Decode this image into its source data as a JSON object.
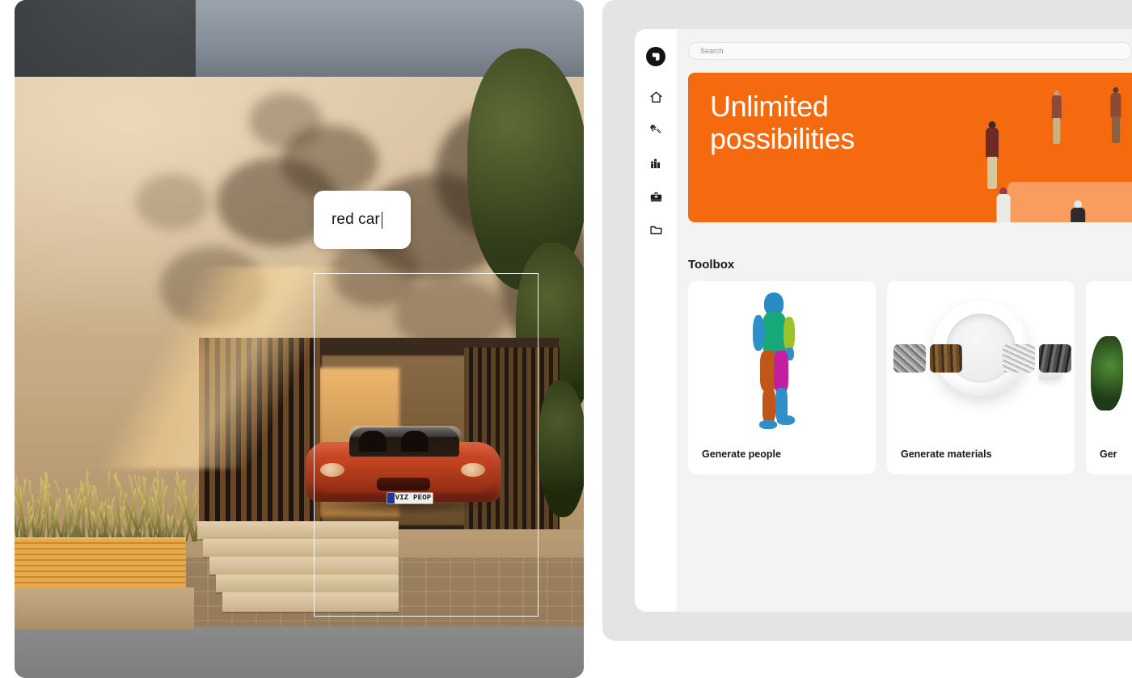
{
  "photo": {
    "name": "architectural-visualization-render",
    "prompt_input": {
      "value": "red car",
      "caret": true
    },
    "selection": {
      "name": "selection-marquee"
    },
    "car": {
      "license_plate": "VIZ PEOP"
    }
  },
  "app": {
    "rail": {
      "logo": "app-logo-icon",
      "items": [
        {
          "name": "home-icon",
          "label": "Home"
        },
        {
          "name": "magic-wand-icon",
          "label": "Generate"
        },
        {
          "name": "library-icon",
          "label": "Library"
        },
        {
          "name": "toolbox-icon",
          "label": "Toolbox"
        },
        {
          "name": "folder-icon",
          "label": "Projects"
        }
      ]
    },
    "search": {
      "placeholder": "Search"
    },
    "banner": {
      "title": "Unlimited\npossibilities",
      "bg_color": "#f66a0f",
      "text_color": "#ffffff"
    },
    "toolbox": {
      "heading": "Toolbox",
      "cards": [
        {
          "label": "Generate people",
          "art": "segmented-human-figure"
        },
        {
          "label": "Generate materials",
          "art": "cup-with-material-swatches"
        },
        {
          "label": "Ger",
          "art": "vegetation"
        }
      ]
    }
  },
  "colors": {
    "accent_orange": "#f66a0f",
    "app_bg": "#f3f3f3",
    "shell_bg": "#e4e4e4",
    "card_bg": "#ffffff",
    "text_dark": "#16191b",
    "text_muted": "#8e9194"
  }
}
